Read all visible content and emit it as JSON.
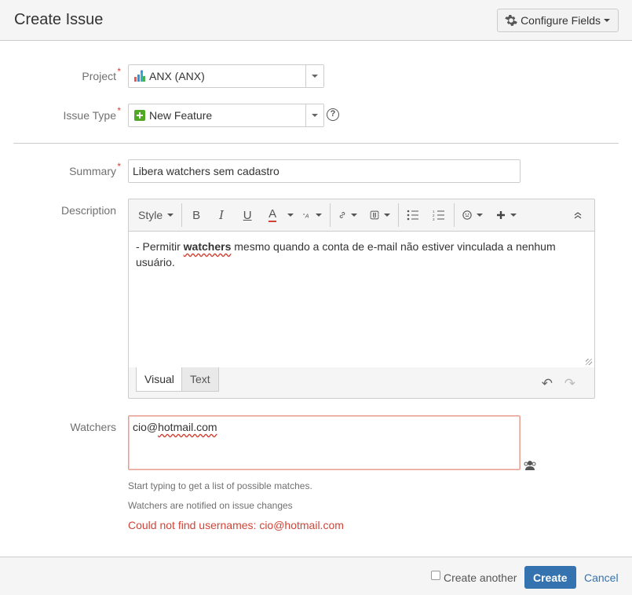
{
  "dialog": {
    "title": "Create Issue",
    "configure_fields": "Configure Fields"
  },
  "fields": {
    "project": {
      "label": "Project",
      "required": "*",
      "value": "ANX (ANX)"
    },
    "issue_type": {
      "label": "Issue Type",
      "required": "*",
      "value": "New Feature",
      "help": "?"
    },
    "summary": {
      "label": "Summary",
      "required": "*",
      "value": "Libera watchers sem cadastro"
    },
    "description": {
      "label": "Description",
      "text_before": "- Permitir ",
      "bold_word": "watchers",
      "text_after": " mesmo quando a conta de e-mail não estiver vinculada a nenhum usuário."
    },
    "watchers": {
      "label": "Watchers",
      "value_prefix": "cio@",
      "value_rest": "hotmail.com",
      "hint_1": "Start typing to get a list of possible matches.",
      "hint_2": "Watchers are notified on issue changes",
      "error": "Could not find usernames: cio@hotmail.com"
    }
  },
  "editor": {
    "style": "Style",
    "bold": "B",
    "italic": "I",
    "underline": "U",
    "color": "A",
    "tabs": {
      "visual": "Visual",
      "text": "Text"
    },
    "icons": [
      "text-size-icon",
      "link-icon",
      "attachment-icon",
      "bullet-list-icon",
      "numbered-list-icon",
      "emoticon-icon",
      "insert-plus-icon",
      "collapse-icon",
      "undo-icon",
      "redo-icon"
    ]
  },
  "footer": {
    "create_another": "Create another",
    "create": "Create",
    "cancel": "Cancel"
  },
  "colors": {
    "accent": "#3572b0",
    "error": "#d04437",
    "new_feature": "#51a825"
  }
}
